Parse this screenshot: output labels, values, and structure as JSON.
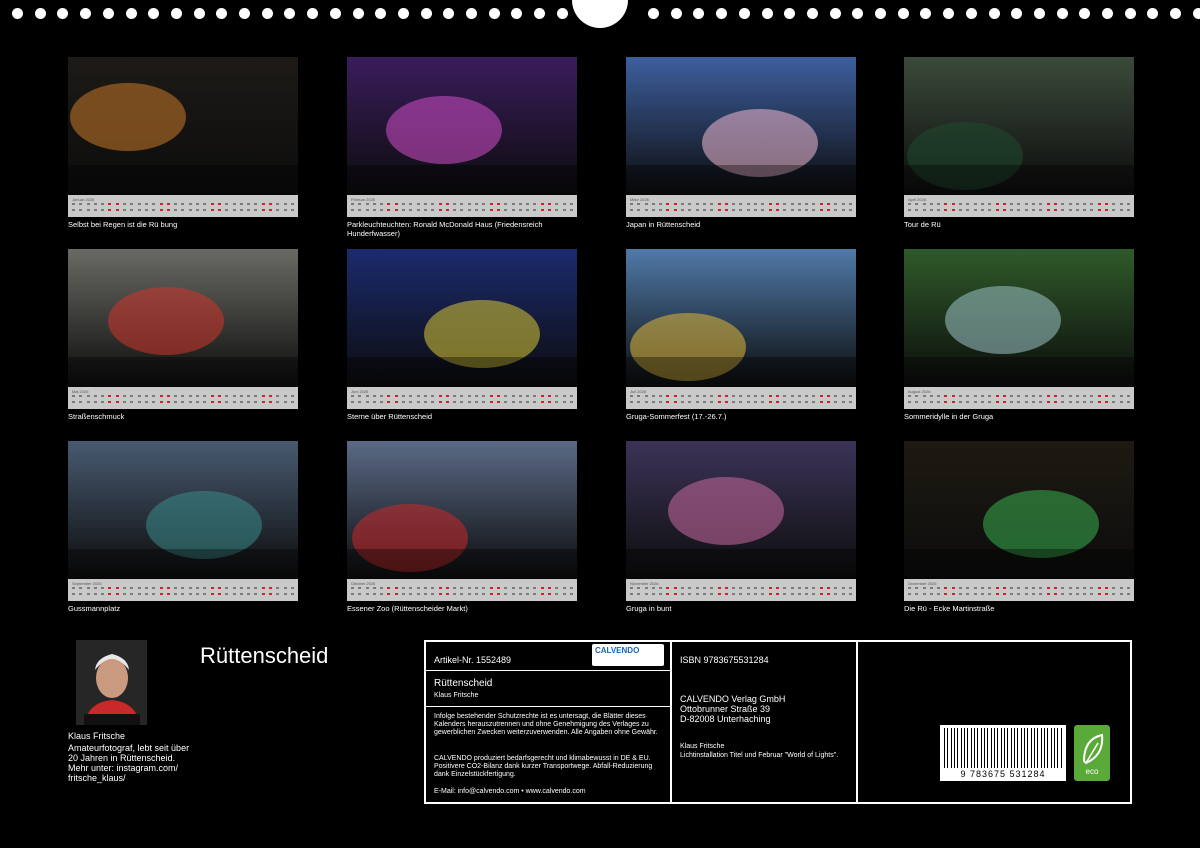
{
  "tiles": [
    {
      "month": "Januar 2026",
      "caption": "Selbst bei Regen ist die Rü bung",
      "bg": "#1d1a17",
      "accent": "#c87a28"
    },
    {
      "month": "Februar 2026",
      "caption": "Parkleuchteuchten: Ronald McDonald Haus (Friedensreich Hunderfwasser)",
      "bg": "#3a1d5c",
      "accent": "#d14fc8"
    },
    {
      "month": "März 2026",
      "caption": "Japan in Rüttenscheid",
      "bg": "#3d5f9e",
      "accent": "#f0b8d0"
    },
    {
      "month": "April 2026",
      "caption": "Tour de Rü",
      "bg": "#3b4a3a",
      "accent": "#1f4a30"
    },
    {
      "month": "Mai 2026",
      "caption": "Straßenschmuck",
      "bg": "#6a6a64",
      "accent": "#d0352a"
    },
    {
      "month": "Juni 2026",
      "caption": "Sterne über Rüttenscheid",
      "bg": "#1b2b6e",
      "accent": "#d8c834"
    },
    {
      "month": "Juli 2026",
      "caption": "Gruga-Sommerfest (17.-26.7.)",
      "bg": "#4f7aa8",
      "accent": "#e0b83a"
    },
    {
      "month": "August 2026",
      "caption": "Sommeridylle in der Gruga",
      "bg": "#2f5a2a",
      "accent": "#9cc3c6"
    },
    {
      "month": "September 2026",
      "caption": "Gussmannplatz",
      "bg": "#485a70",
      "accent": "#3a8a8a"
    },
    {
      "month": "Oktober 2026",
      "caption": "Essener Zoo (Rüttenscheider Markt)",
      "bg": "#5a6a86",
      "accent": "#c82828"
    },
    {
      "month": "November 2026",
      "caption": "Gruga in bunt",
      "bg": "#3c3458",
      "accent": "#c86aa0"
    },
    {
      "month": "Dezember 2026",
      "caption": "Die Rü - Ecke Martinstraße",
      "bg": "#1e1a12",
      "accent": "#38b050"
    }
  ],
  "title": "Rüttenscheid",
  "author": {
    "name": "Klaus Fritsche",
    "bio": "Amateurfotograf, lebt seit über 20 Jahren in Rüttenscheid. Mehr unter: instagram.com/ fritsche_klaus/"
  },
  "info": {
    "artikel": "Artikel-Nr. 1552489",
    "logo": "CALVENDO",
    "book_title": "Rüttenscheid",
    "book_author": "Klaus Fritsche",
    "legal1": "Infolge bestehender Schutzrechte ist es untersagt, die Blätter dieses Kalenders herauszutrennen und ohne Genehmigung des Verlages zu gewerblichen Zwecken weiterzuverwenden. Alle Angaben ohne Gewähr.",
    "legal2": "CALVENDO produziert bedarfsgerecht und klimabewusst in DE & EU. Positivere CO2-Bilanz dank kurzer Transportwege. Abfall-Reduzierung dank Einzelstückfertigung.",
    "contact": "E-Mail: info@calvendo.com • www.calvendo.com",
    "isbn": "ISBN 9783675531284",
    "publisher1": "CALVENDO Verlag GmbH",
    "publisher2": "Ottobrunner Straße 39",
    "publisher3": "D-82008 Unterhaching",
    "cover_author": "Klaus Fritsche",
    "cover_note": "Lichtinstallation Titel und Februar \"World of Lights\".",
    "barcode_number": "9 783675 531284",
    "eco": "eco"
  }
}
